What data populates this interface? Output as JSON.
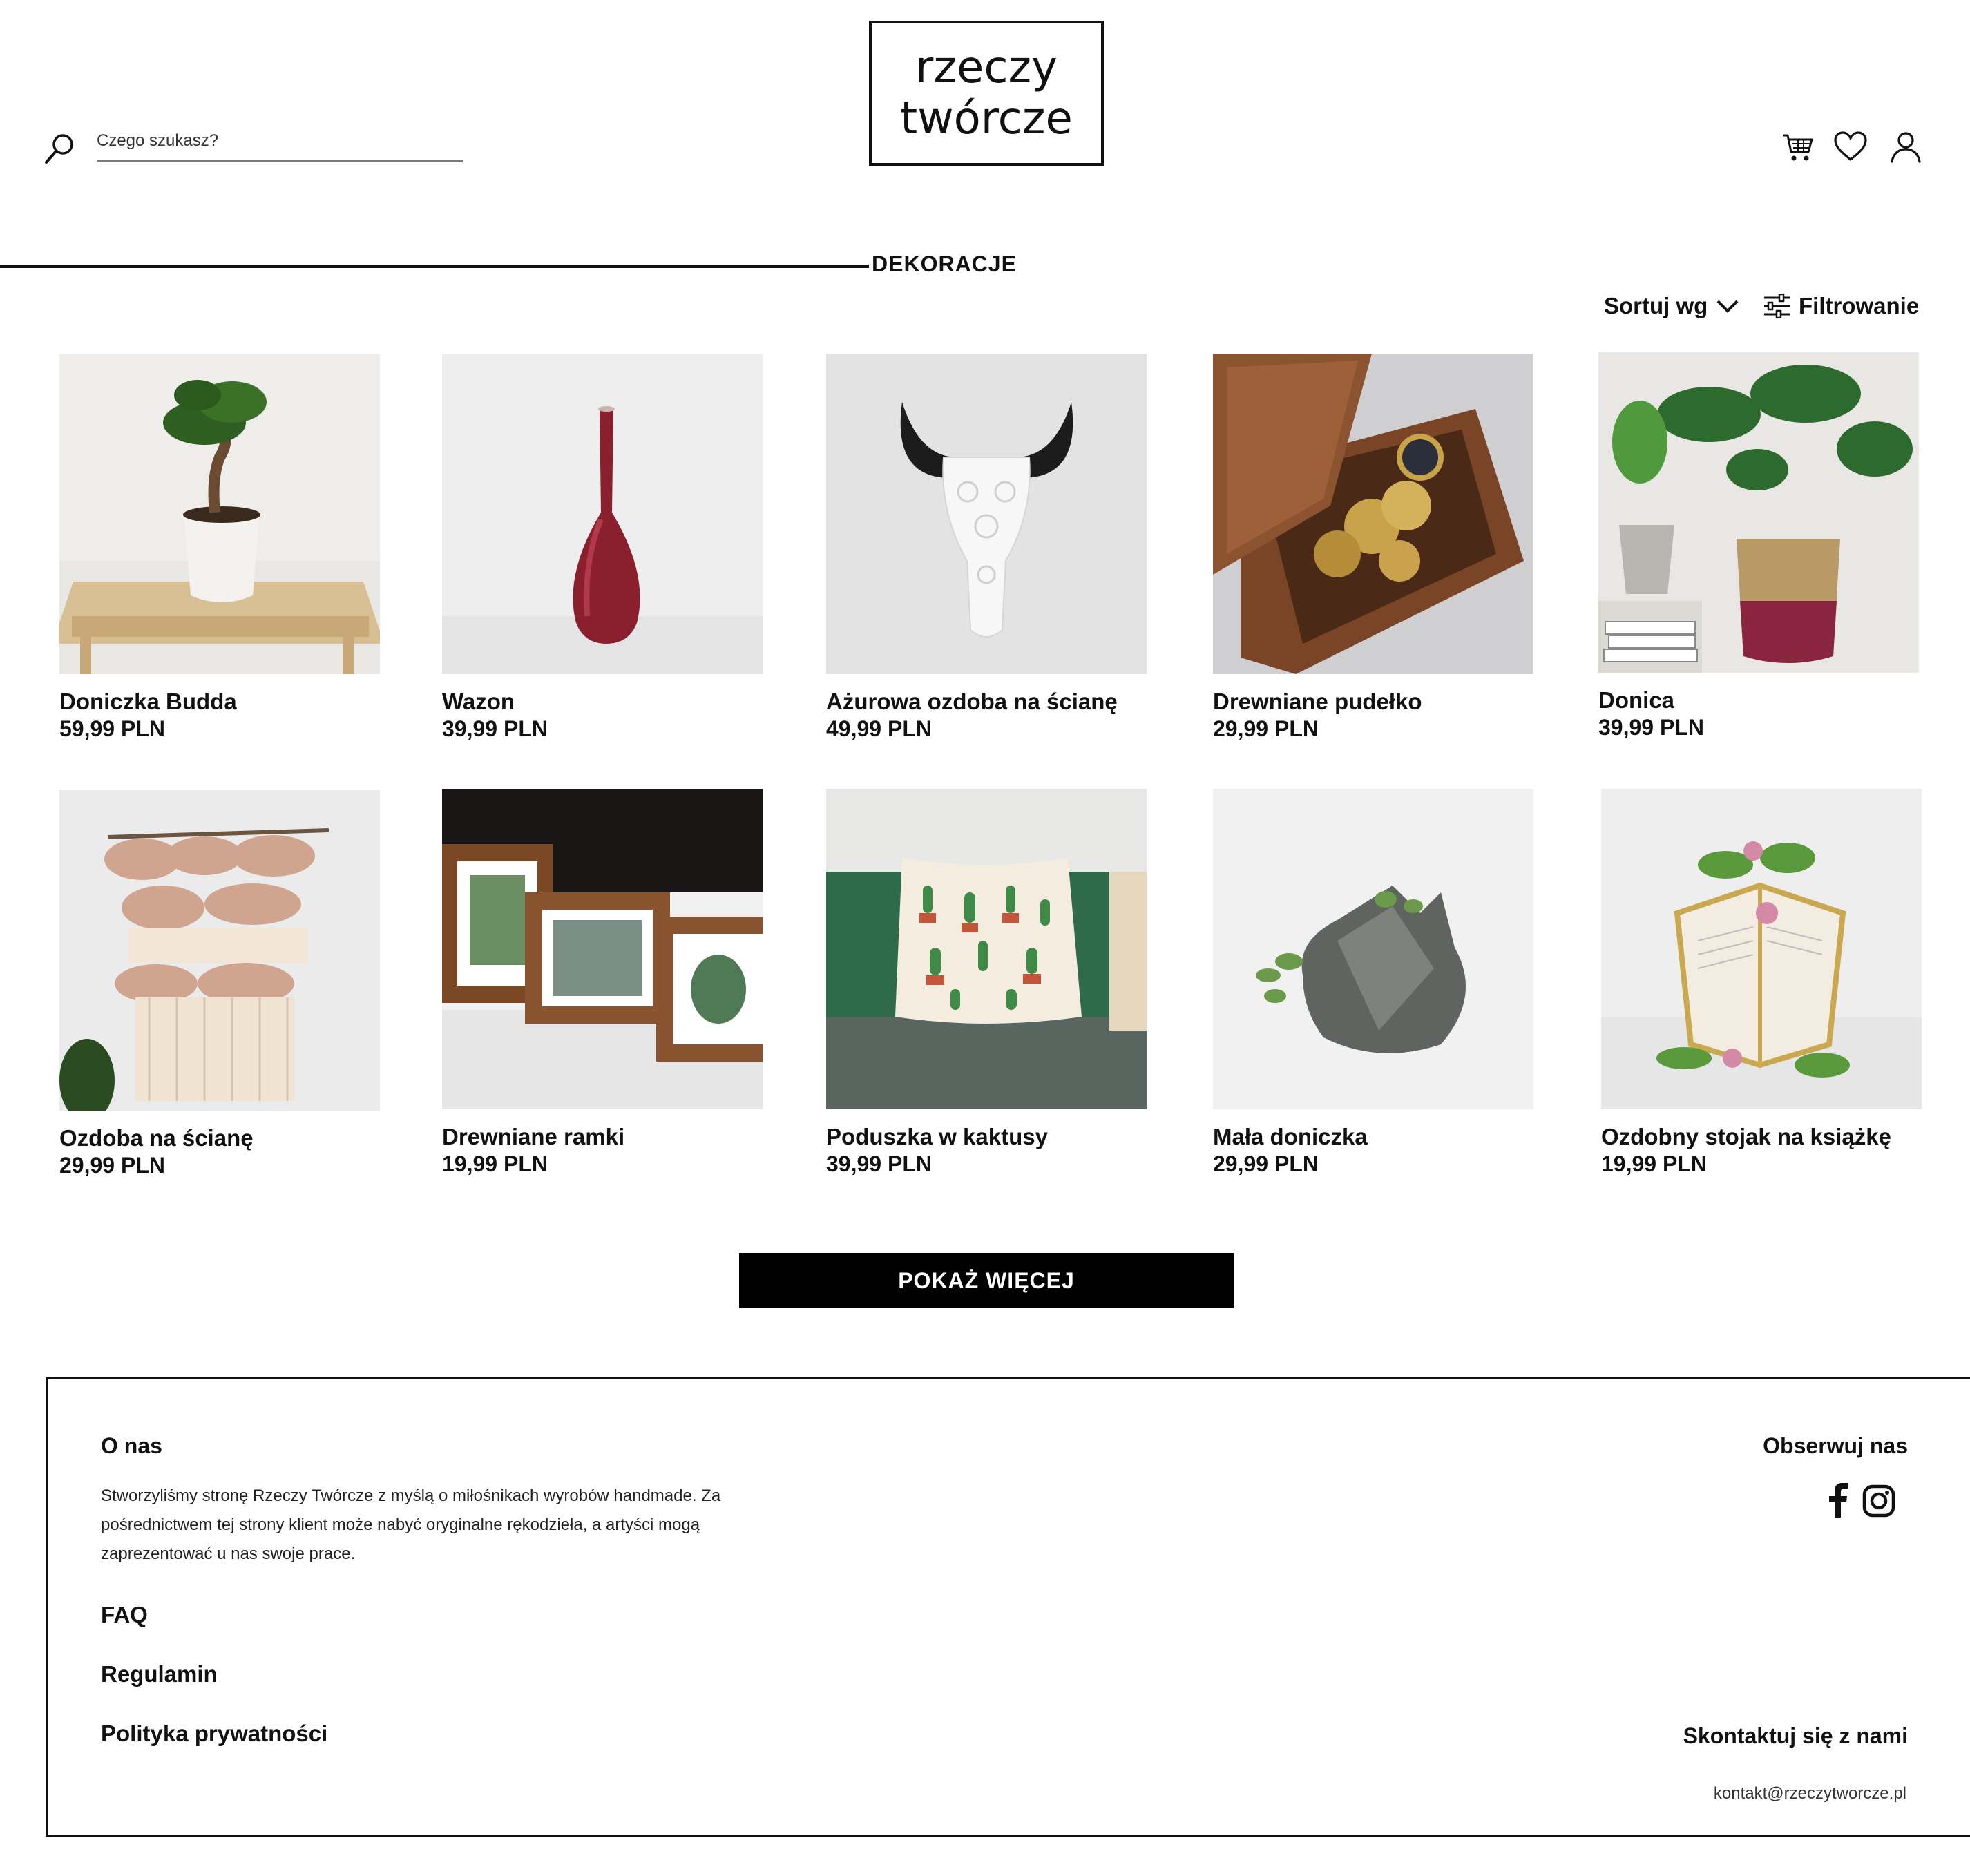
{
  "header": {
    "search_placeholder": "Czego szukasz?",
    "logo_line1": "rzeczy",
    "logo_line2": "twórcze"
  },
  "section": {
    "title": "DEKORACJE",
    "sort_label": "Sortuj wg",
    "filter_label": "Filtrowanie"
  },
  "products": [
    {
      "name": "Doniczka Budda",
      "price": "59,99 PLN"
    },
    {
      "name": "Wazon",
      "price": "39,99 PLN"
    },
    {
      "name": "Ażurowa ozdoba na ścianę",
      "price": "49,99 PLN"
    },
    {
      "name": "Drewniane pudełko",
      "price": "29,99 PLN"
    },
    {
      "name": "Donica",
      "price": "39,99 PLN"
    },
    {
      "name": "Ozdoba na ścianę",
      "price": "29,99 PLN"
    },
    {
      "name": "Drewniane ramki",
      "price": "19,99 PLN"
    },
    {
      "name": "Poduszka w kaktusy",
      "price": "39,99 PLN"
    },
    {
      "name": "Mała doniczka",
      "price": "29,99 PLN"
    },
    {
      "name": "Ozdobny stojak na książkę",
      "price": "19,99 PLN"
    }
  ],
  "show_more_label": "POKAŻ WIĘCEJ",
  "footer": {
    "about_heading": "O nas",
    "about_text": "Stworzyliśmy stronę Rzeczy Twórcze z myślą o miłośnikach wyrobów handmade. Za pośrednictwem tej strony klient może nabyć oryginalne rękodzieła, a artyści mogą zaprezentować u nas swoje prace.",
    "links": [
      "FAQ",
      "Regulamin",
      "Polityka prywatności"
    ],
    "follow_heading": "Obserwuj nas",
    "contact_heading": "Skontaktuj się z nami",
    "contact_email": "kontakt@rzeczytworcze.pl"
  }
}
